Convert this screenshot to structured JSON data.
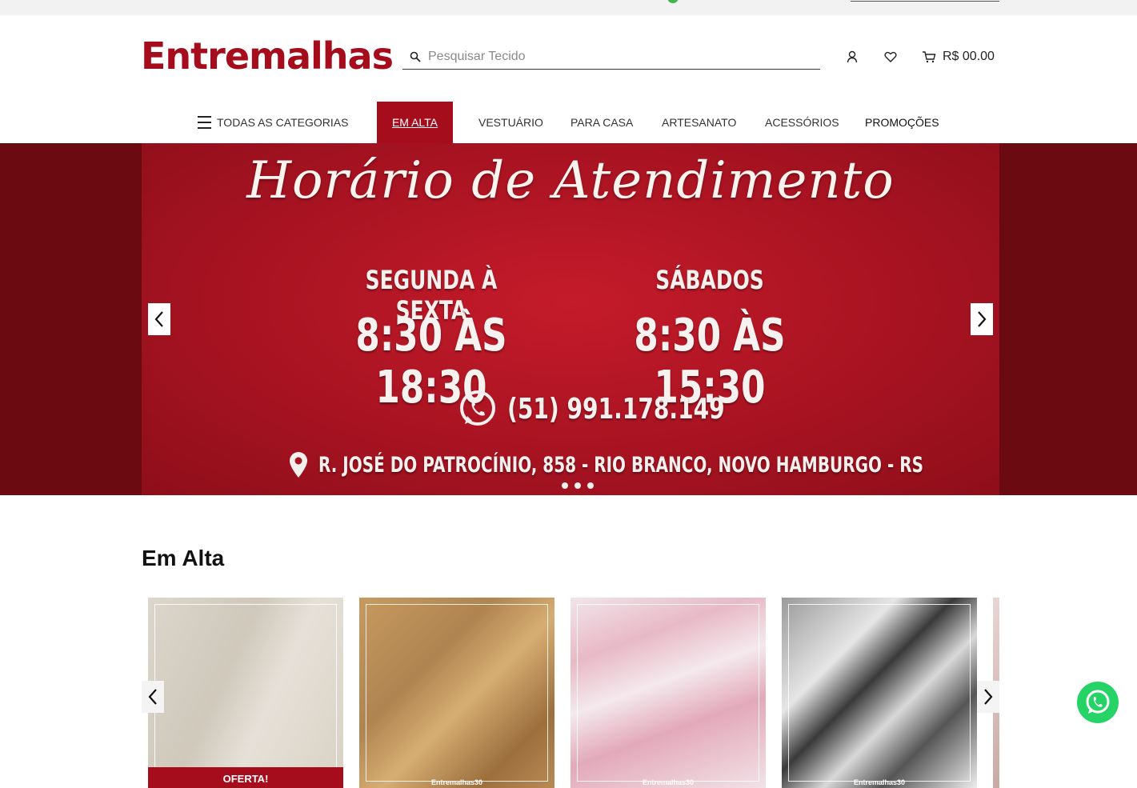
{
  "brand": {
    "logo_text": "Entremalhas",
    "accent": "#a50d1d"
  },
  "search": {
    "placeholder": "Pesquisar Tecido",
    "value": ""
  },
  "header": {
    "cart_total": "R$ 00.00",
    "icons": [
      "user-icon",
      "heart-icon",
      "cart-icon",
      "search-icon"
    ]
  },
  "nav": {
    "all_categories": "TODAS AS CATEGORIAS",
    "items": [
      "EM ALTA",
      "VESTUÁRIO",
      "PARA CASA",
      "ARTESANATO",
      "ACESSÓRIOS",
      "PROMOÇÕES"
    ],
    "active": "EM ALTA"
  },
  "banner": {
    "title": "Horário de Atendimento",
    "weekday_label": "SEGUNDA À SEXTA",
    "weekday_hours": "8:30 ÀS 18:30",
    "saturday_label": "SÁBADOS",
    "saturday_hours": "8:30 ÀS 15:30",
    "phone": "(51) 991.178.149",
    "address": "R. JOSÉ DO PATROCÍNIO, 858 - RIO BRANCO, NOVO HAMBURGO - RS",
    "slides_count": 3
  },
  "section": {
    "title": "Em Alta"
  },
  "products": [
    {
      "badge": "OFERTA!",
      "watermark": ""
    },
    {
      "badge": "",
      "watermark": "Entremalhas30"
    },
    {
      "badge": "",
      "watermark": "Entremalhas30"
    },
    {
      "badge": "",
      "watermark": "Entremalhas30"
    }
  ]
}
